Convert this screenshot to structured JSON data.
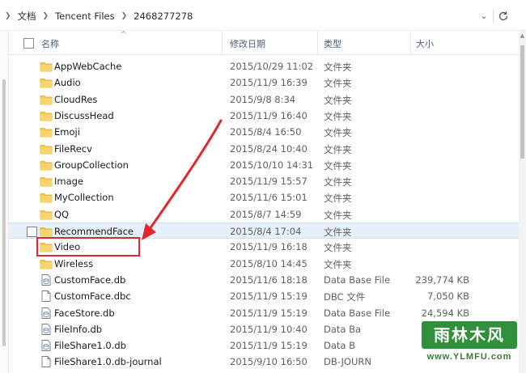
{
  "address_bar": {
    "crumbs": [
      "文档",
      "Tencent Files",
      "2468277278"
    ],
    "dropdown_glyph": "⌄"
  },
  "header": {
    "name": "名称",
    "date_modified": "修改日期",
    "type": "类型",
    "size": "大小"
  },
  "rows": [
    {
      "name": "AppWebCache",
      "date": "2015/10/29 11:02",
      "type": "文件夹",
      "size": "",
      "icon": "folder-icon"
    },
    {
      "name": "Audio",
      "date": "2015/11/9 16:39",
      "type": "文件夹",
      "size": "",
      "icon": "folder-icon"
    },
    {
      "name": "CloudRes",
      "date": "2015/9/8 8:34",
      "type": "文件夹",
      "size": "",
      "icon": "folder-icon"
    },
    {
      "name": "DiscussHead",
      "date": "2015/11/9 16:40",
      "type": "文件夹",
      "size": "",
      "icon": "folder-icon"
    },
    {
      "name": "Emoji",
      "date": "2015/8/4 16:50",
      "type": "文件夹",
      "size": "",
      "icon": "folder-icon"
    },
    {
      "name": "FileRecv",
      "date": "2015/8/24 10:40",
      "type": "文件夹",
      "size": "",
      "icon": "folder-icon"
    },
    {
      "name": "GroupCollection",
      "date": "2015/10/10 14:31",
      "type": "文件夹",
      "size": "",
      "icon": "folder-icon"
    },
    {
      "name": "Image",
      "date": "2015/11/9 15:57",
      "type": "文件夹",
      "size": "",
      "icon": "folder-icon"
    },
    {
      "name": "MyCollection",
      "date": "2015/11/6 15:01",
      "type": "文件夹",
      "size": "",
      "icon": "folder-icon"
    },
    {
      "name": "QQ",
      "date": "2015/8/7 14:59",
      "type": "文件夹",
      "size": "",
      "icon": "folder-icon"
    },
    {
      "name": "RecommendFace",
      "date": "2015/8/4 17:04",
      "type": "文件夹",
      "size": "",
      "icon": "folder-icon",
      "selected": true
    },
    {
      "name": "Video",
      "date": "2015/11/9 16:18",
      "type": "文件夹",
      "size": "",
      "icon": "folder-icon"
    },
    {
      "name": "Wireless",
      "date": "2015/8/10 14:45",
      "type": "文件夹",
      "size": "",
      "icon": "folder-icon"
    },
    {
      "name": "CustomFace.db",
      "date": "2015/11/6 18:18",
      "type": "Data Base File",
      "size": "239,774 KB",
      "icon": "db-file-icon"
    },
    {
      "name": "CustomFace.dbc",
      "date": "2015/11/9 15:19",
      "type": "DBC 文件",
      "size": "7,050 KB",
      "icon": "file-icon"
    },
    {
      "name": "FaceStore.db",
      "date": "2015/11/9 15:19",
      "type": "Data Base File",
      "size": "24,594 KB",
      "icon": "db-file-icon"
    },
    {
      "name": "FileInfo.db",
      "date": "2015/11/9 10:40",
      "type": "Data Ba",
      "size": "",
      "icon": "db-file-icon"
    },
    {
      "name": "FileShare1.0.db",
      "date": "2015/11/9 15:19",
      "type": "Data B",
      "size": "",
      "icon": "db-file-icon"
    },
    {
      "name": "FileShare1.0.db-journal",
      "date": "2015/9/10 16:50",
      "type": "DB-JOURN",
      "size": "",
      "icon": "file-icon"
    }
  ],
  "watermark": {
    "logo_text": "雨林木风",
    "url_text": "www.YLMFU.com"
  },
  "colors": {
    "accent_red": "#e0282e",
    "folder_yellow": "#f5c84c",
    "selection_blue": "#e6f0fa"
  }
}
